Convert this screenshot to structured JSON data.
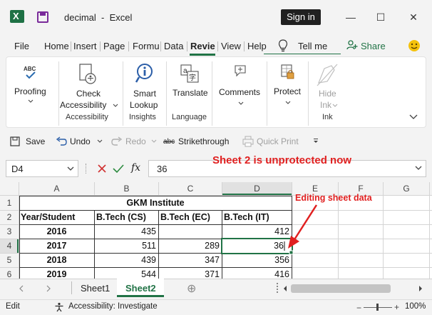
{
  "window": {
    "doc_title": "decimal  -  Excel",
    "signin_label": "Sign in",
    "controls": [
      "—",
      "☐",
      "✕"
    ]
  },
  "tabs": {
    "file": "File",
    "home": "Home",
    "insert": "Insert",
    "page": "Page",
    "formulas": "Formu",
    "data": "Data",
    "review": "Revie",
    "view": "View",
    "help": "Help",
    "tellme": "Tell me",
    "share": "Share"
  },
  "ribbon": {
    "proofing": "Proofing",
    "check_accessibility_1": "Check",
    "check_accessibility_2": "Accessibility",
    "smart_lookup_1": "Smart",
    "smart_lookup_2": "Lookup",
    "translate": "Translate",
    "comments": "Comments",
    "protect": "Protect",
    "hide_ink_1": "Hide",
    "hide_ink_2": "Ink",
    "groups": {
      "accessibility": "Accessibility",
      "insights": "Insights",
      "language": "Language",
      "ink": "Ink"
    }
  },
  "qat": {
    "save": "Save",
    "undo": "Undo",
    "redo": "Redo",
    "strikethrough": "Strikethrough",
    "quick_print": "Quick Print",
    "abc": "abc"
  },
  "formula_bar": {
    "name_box": "D4",
    "fx": "fx",
    "value": "36"
  },
  "grid": {
    "columns": [
      "A",
      "B",
      "C",
      "D",
      "E",
      "F",
      "G"
    ],
    "rows": [
      "1",
      "2",
      "3",
      "4",
      "5",
      "6"
    ],
    "title": "GKM Institute",
    "headers": [
      "Year/Student",
      "B.Tech (CS)",
      "B.Tech (EC)",
      "B.Tech (IT)"
    ],
    "data": [
      [
        "2016",
        "435",
        "",
        "412"
      ],
      [
        "2017",
        "511",
        "289",
        "36"
      ],
      [
        "2018",
        "439",
        "347",
        "356"
      ],
      [
        "2019",
        "544",
        "371",
        "416"
      ]
    ]
  },
  "sheets": {
    "sheet1": "Sheet1",
    "sheet2": "Sheet2",
    "add": "⊕"
  },
  "status": {
    "mode": "Edit",
    "accessibility": "Accessibility: Investigate",
    "zoom": "100%"
  },
  "annotations": {
    "headline": "Sheet 2 is unprotected now",
    "note": "Editing sheet data"
  },
  "colors": {
    "excel_green": "#217346",
    "annotation_red": "#e02020"
  }
}
